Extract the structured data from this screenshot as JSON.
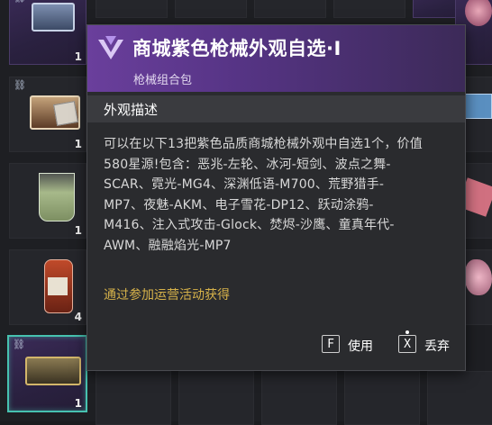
{
  "inventory": {
    "left_slots": [
      {
        "name": "slot-weapon-case-blue",
        "count": "1",
        "linked": true
      },
      {
        "name": "slot-supply-crate",
        "count": "1",
        "linked": true
      },
      {
        "name": "slot-drink-glass",
        "count": "1",
        "linked": false
      },
      {
        "name": "slot-medicine-bottle",
        "count": "4",
        "linked": false
      },
      {
        "name": "slot-gold-weapon-case",
        "count": "1",
        "linked": true,
        "selected": true
      }
    ]
  },
  "tooltip": {
    "title": "商城紫色枪械外观自选·I",
    "subtitle": "枪械组合包",
    "section_title": "外观描述",
    "description_lines": [
      "可以在以下13把紫色品质商城枪械外观中自选1个，价值",
      "580星源!包含：恶兆-左轮、冰河-短剑、波点之舞-",
      "SCAR、霓光-MG4、深渊低语-M700、荒野猎手-",
      "MP7、夜魅-AKM、电子雪花-DP12、跃动涂鸦-",
      "M416、注入式攻击-Glock、焚烬-沙鹰、童真年代-",
      "AWM、融融焰光-MP7"
    ],
    "source": "通过参加运营活动获得",
    "actions": {
      "use_key": "F",
      "use_label": "使用",
      "discard_key": "X",
      "discard_label": "丢弃"
    },
    "colors": {
      "header_purple": "#6a3f9c",
      "source_gold": "#d6b24a",
      "selected_border": "#47c2b0"
    }
  }
}
